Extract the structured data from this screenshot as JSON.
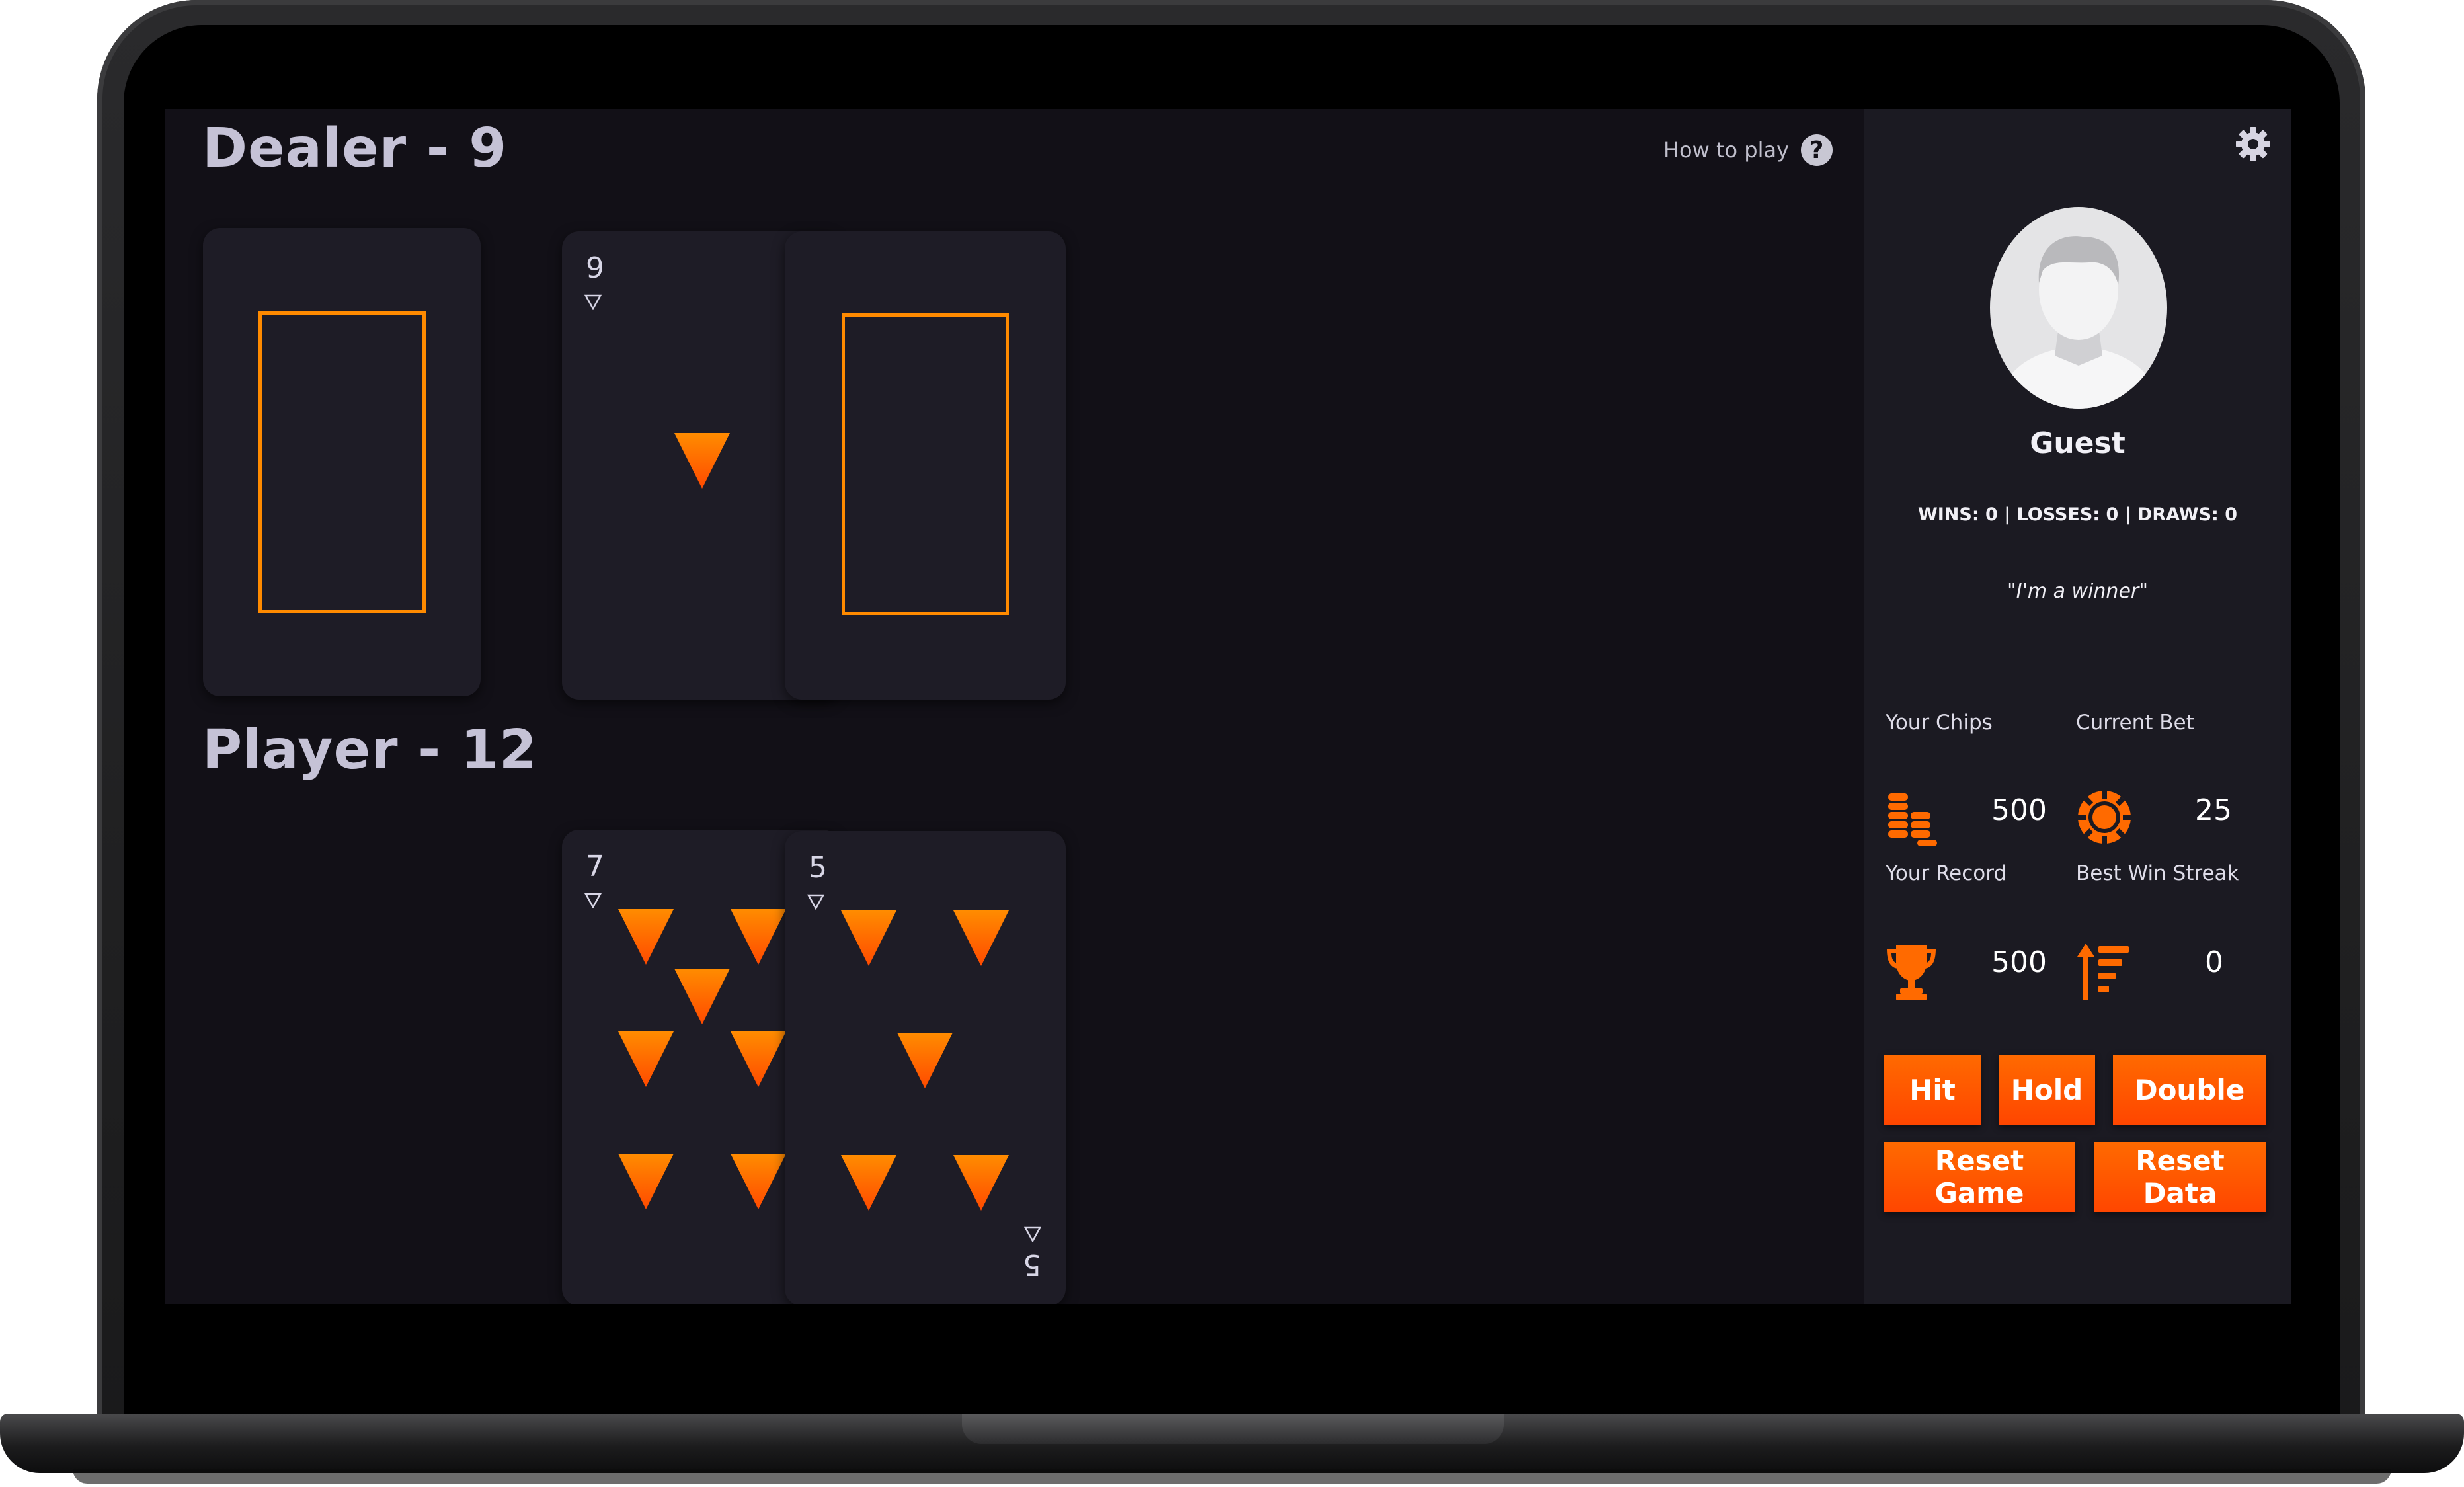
{
  "dealer": {
    "heading": "Dealer - 9"
  },
  "player": {
    "heading": "Player - 12"
  },
  "help": {
    "label": "How to play",
    "icon": "question-circle-icon",
    "glyph": "?"
  },
  "dealer_cards": [
    {
      "face_down": true
    },
    {
      "rank": "9",
      "face_down": false
    },
    {
      "face_down": true
    }
  ],
  "player_cards": [
    {
      "rank": "7"
    },
    {
      "rank": "5"
    }
  ],
  "profile": {
    "name": "Guest",
    "record": "WINS: 0 | LOSSES: 0 | DRAWS: 0",
    "quote": "\"I'm a winner\""
  },
  "stats": {
    "chips_label": "Your Chips",
    "chips_value": "500",
    "bet_label": "Current Bet",
    "bet_value": "25",
    "record_label": "Your Record",
    "record_value": "500",
    "streak_label": "Best Win Streak",
    "streak_value": "0"
  },
  "actions": {
    "hit": "Hit",
    "hold": "Hold",
    "double": "Double",
    "reset_game": "Reset Game",
    "reset_data": "Reset Data"
  },
  "colors": {
    "accent": "#ff6a00",
    "card_back_frame": "#ff8a00",
    "background": "#121017",
    "panel": "#1b1a22"
  }
}
